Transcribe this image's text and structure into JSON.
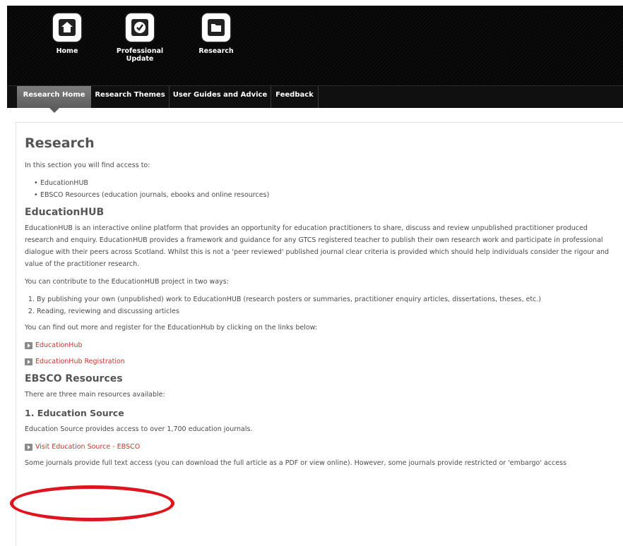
{
  "top_nav": [
    {
      "label": "Home",
      "icon": "home-icon"
    },
    {
      "label": "Professional Update",
      "icon": "checkmark-icon"
    },
    {
      "label": "Research",
      "icon": "folder-icon"
    }
  ],
  "tabs": [
    {
      "label": "Research Home",
      "active": true
    },
    {
      "label": "Research Themes",
      "active": false
    },
    {
      "label": "User Guides and Advice",
      "active": false
    },
    {
      "label": "Feedback",
      "active": false
    }
  ],
  "page": {
    "title": "Research",
    "intro": "In this section you will find access to:",
    "intro_list": [
      "EducationHUB",
      "EBSCO Resources (education journals, ebooks and online resources)"
    ]
  },
  "education_hub": {
    "heading": "EducationHUB",
    "description": "EducationHUB is an interactive online platform that provides an opportunity for education practitioners to share, discuss and review unpublished practitioner produced research and enquiry. EducationHUB provides a framework and guidance for any GTCS registered teacher to publish their own research work and participate in professional dialogue with their peers across Scotland. Whilst this is not a 'peer reviewed' published journal clear criteria is provided which should help individuals consider the rigour and value of the practitioner research.",
    "contribute_intro": "You can contribute to the EducationHUB project in two ways:",
    "contribute_list": [
      "By publishing your own (unpublished) work to EducationHUB (research posters or summaries, practitioner enquiry articles, dissertations, theses, etc.)",
      "Reading, reviewing and discussing articles"
    ],
    "register_text": "You can find out more and register for the EducationHub by clicking on the links below:",
    "links": [
      "EducationHub",
      "EducationHub Registration"
    ]
  },
  "ebsco": {
    "heading": "EBSCO Resources",
    "intro": "There are three main resources available:",
    "source_heading": "1. Education Source",
    "source_text": "Education Source provides access to over 1,700 education journals.",
    "source_link": "Visit Education Source - EBSCO",
    "fulltext_text": "Some journals provide full text access (you can download the full article as a PDF or view online). However, some journals provide restricted or 'embargo' access"
  },
  "colors": {
    "header_bg": "#0a0a0a",
    "active_tab": "#6e6e6e",
    "link": "#c0392b",
    "highlight": "#e0141e"
  }
}
